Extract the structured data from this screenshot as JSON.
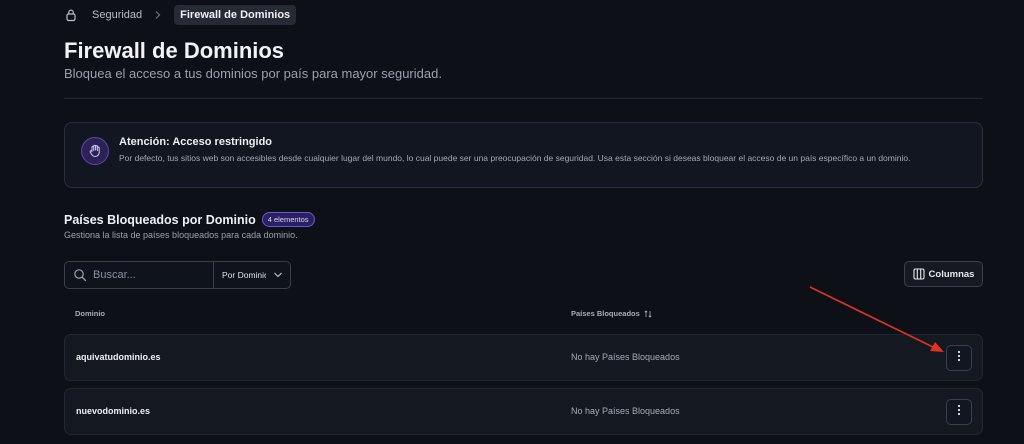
{
  "breadcrumb": {
    "parent": "Seguridad",
    "current": "Firewall de Dominios"
  },
  "page": {
    "title": "Firewall de Dominios",
    "subtitle": "Bloquea el acceso a tus dominios por país para mayor seguridad."
  },
  "alert": {
    "title": "Atención: Acceso restringido",
    "text": "Por defecto, tus sitios web son accesibles desde cualquier lugar del mundo, lo cual puede ser una preocupación de seguridad. Usa esta sección si deseas bloquear el acceso de un país específico a un dominio.",
    "icon": "hand-icon"
  },
  "section": {
    "title": "Países Bloqueados por Dominio",
    "badge": "4 elementos",
    "subtitle": "Gestiona la lista de países bloqueados para cada dominio."
  },
  "toolbar": {
    "search_placeholder": "Buscar...",
    "filter_label": "Por Dominio",
    "columns_label": "Columnas"
  },
  "table": {
    "headers": [
      "Dominio",
      "Países Bloqueados"
    ],
    "rows": [
      {
        "domain": "aquivatudominio.es",
        "blocked": "No hay Países Bloqueados"
      },
      {
        "domain": "nuevodominio.es",
        "blocked": "No hay Países Bloqueados"
      }
    ]
  },
  "colors": {
    "background": "#0d1017",
    "accent": "#6a55d8",
    "annotation_arrow": "#e0331f"
  }
}
